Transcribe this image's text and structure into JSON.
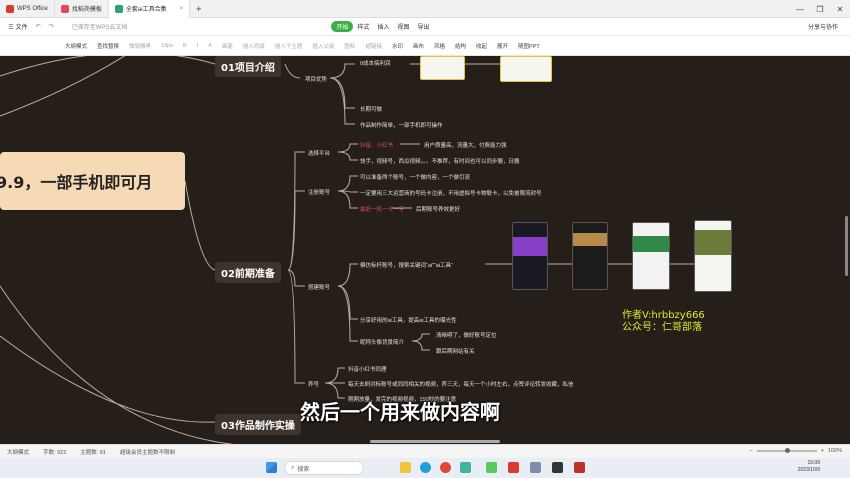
{
  "tabs": [
    {
      "label": "WPS Office",
      "color": "#d83b30",
      "active": false
    },
    {
      "label": "找稻壳模板",
      "color": "#e24a5a",
      "active": false
    },
    {
      "label": "全套ai工具合集",
      "color": "#2aa56e",
      "active": true
    }
  ],
  "tab_add": "+",
  "window_controls": {
    "minimize": "—",
    "maximize": "❐",
    "close": "✕"
  },
  "menubar": {
    "file": "三 文件",
    "sync_note": "已保存至WPS云文档",
    "items": [
      "开始",
      "样式",
      "插入",
      "视图",
      "导出"
    ],
    "share": "分享与协作"
  },
  "toolbar": {
    "items": [
      "大纲模式",
      "查找替换",
      "微软雅黑",
      "18px",
      "B",
      "I",
      "A",
      "画笔",
      "插入同级",
      "插入子主题",
      "插入父级",
      "图标",
      "超链接",
      "水印",
      "画布",
      "风格",
      "结构",
      "收起",
      "展开",
      "随图PPT"
    ]
  },
  "mindmap": {
    "root": "9.9，一部手机即可月",
    "main_nodes": [
      {
        "label": "01项目介绍"
      },
      {
        "label": "02前期准备"
      },
      {
        "label": "03作品制作实操"
      }
    ],
    "branches": {
      "project_advantage": "项目优势",
      "low_cost": "0成本搞利润",
      "long_term": "长期可做",
      "simple": "作品制作简单，一部手机即可操作",
      "choose_platform": "选择平台",
      "platform_red": "抖音、小红书",
      "platform_red_note": "用户质量高，流量大，付费能力强",
      "platform_others": "快手，视频号，西瓜视频。。。不推荐，有时间也可以同步搬，日搬",
      "register_account": "注册账号",
      "reg_note1": "可以准备两个账号，一个做内容，一个做引流",
      "reg_note2": "一定要用三大运营商的号码卡注册，不用虚拟号卡物联卡，以免被限流封号",
      "reg_note3": "最好一机一卡一号",
      "reg_note3b": "后期账号养效更好",
      "setup_account": "搭建账号",
      "setup_note": "模仿标杆账号，搜索关键词“ai”“ai工具”",
      "setup_note2": "分享好用的ai工具，提高ai工具的曝光性",
      "profile": "昵称头像背景简介",
      "profile_note1": "清晰明了，做好账号定位",
      "profile_note2": "跟后期网站有关",
      "nurture": "养号",
      "nurture_1": "抖音小红书同理",
      "nurture_2": "每天去刷对标账号或同同相关的视频，养三天，每天一个小时左右，点赞评论转发收藏，私信",
      "nurture_3": "刚刚放量，发完的视频视频，150秒的要注意"
    }
  },
  "watermark": {
    "line1": "作者V:hrbbzy666",
    "line2": "公众号：仁哥部落"
  },
  "subtitle": "然后一个用来做内容啊",
  "statusbar": {
    "mode": "大纲模式",
    "word_label": "字数",
    "word_count": "922",
    "topic_label": "主题数",
    "topic_count": "81",
    "vip_note": "超级会员主题数不限制",
    "zoom": "100%"
  },
  "taskbar": {
    "search_placeholder": "搜索",
    "time": "15:09",
    "date": "2023/10/9"
  },
  "colors": {
    "canvas_bg": "#261e18",
    "root_bg": "#f6d9b5",
    "line_color": "#b9aea2",
    "accent_green": "#3bb04a",
    "watermark": "#d4f02b"
  }
}
